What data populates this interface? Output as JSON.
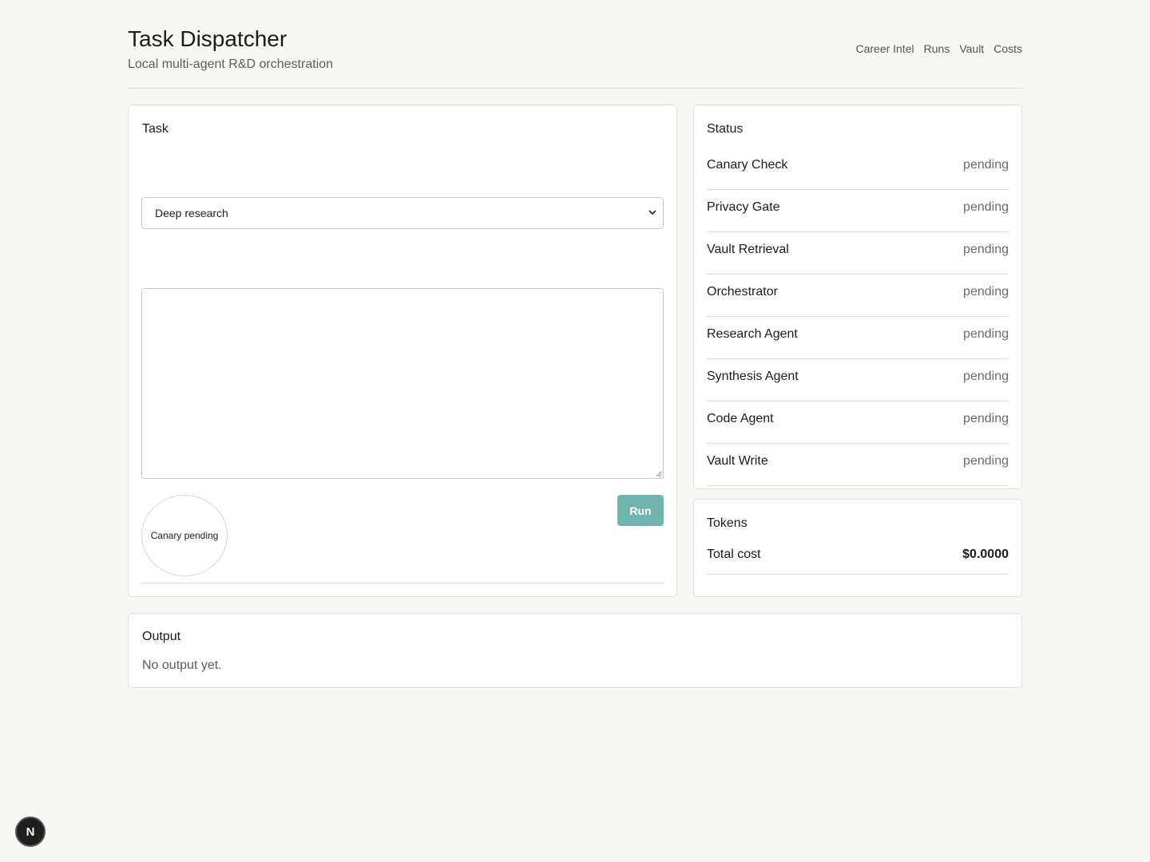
{
  "header": {
    "title": "Task Dispatcher",
    "subtitle": "Local multi-agent R&D orchestration",
    "nav": [
      "Career Intel",
      "Runs",
      "Vault",
      "Costs"
    ]
  },
  "task": {
    "heading": "Task",
    "mode_selected": "Deep research",
    "prompt_value": "",
    "canary_label": "Canary pending",
    "run_label": "Run"
  },
  "status": {
    "heading": "Status",
    "items": [
      {
        "name": "Canary Check",
        "state": "pending"
      },
      {
        "name": "Privacy Gate",
        "state": "pending"
      },
      {
        "name": "Vault Retrieval",
        "state": "pending"
      },
      {
        "name": "Orchestrator",
        "state": "pending"
      },
      {
        "name": "Research Agent",
        "state": "pending"
      },
      {
        "name": "Synthesis Agent",
        "state": "pending"
      },
      {
        "name": "Code Agent",
        "state": "pending"
      },
      {
        "name": "Vault Write",
        "state": "pending"
      }
    ]
  },
  "tokens": {
    "heading": "Tokens",
    "total_cost_label": "Total cost",
    "total_cost_value": "$0.0000"
  },
  "output": {
    "heading": "Output",
    "text": "No output yet."
  },
  "devtools": {
    "badge_letter": "N"
  },
  "colors": {
    "accent": "#6fb4ad",
    "background": "#f7f7f4"
  }
}
